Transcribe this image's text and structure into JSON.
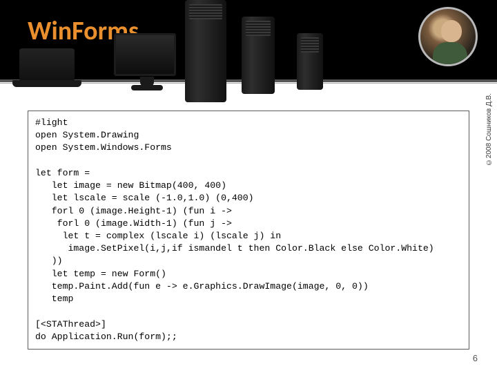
{
  "header": {
    "title": "WinForms"
  },
  "code": {
    "lines": [
      "#light",
      "open System.Drawing",
      "open System.Windows.Forms",
      "",
      "let form =",
      "   let image = new Bitmap(400, 400)",
      "   let lscale = scale (-1.0,1.0) (0,400)",
      "   forl 0 (image.Height-1) (fun i ->",
      "    forl 0 (image.Width-1) (fun j ->",
      "     let t = complex (lscale i) (lscale j) in",
      "      image.SetPixel(i,j,if ismandel t then Color.Black else Color.White)",
      "   ))",
      "   let temp = new Form()",
      "   temp.Paint.Add(fun e -> e.Graphics.DrawImage(image, 0, 0))",
      "   temp",
      "",
      "[<STAThread>]",
      "do Application.Run(form);;"
    ]
  },
  "footer": {
    "copyright": "©2008 Сошников Д.В.",
    "page": "6"
  }
}
